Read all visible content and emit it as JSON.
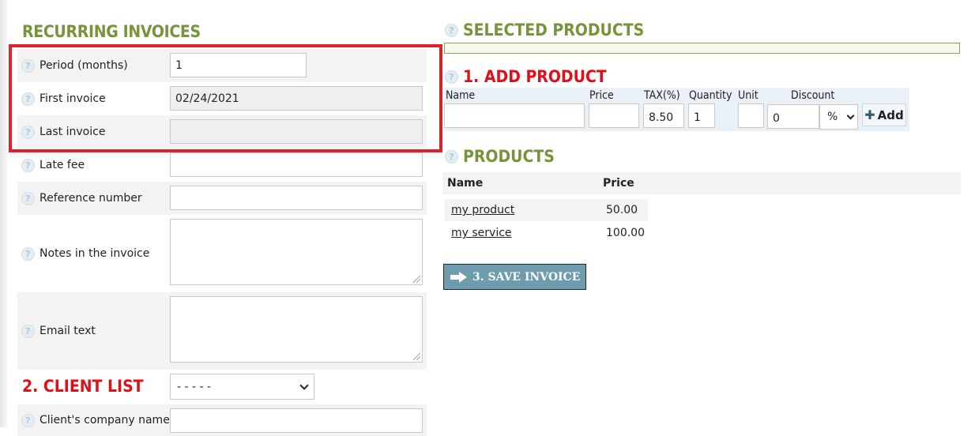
{
  "recurring": {
    "title": "RECURRING INVOICES",
    "fields": [
      {
        "label": "Period (months)",
        "value": "1"
      },
      {
        "label": "First invoice",
        "value": "02/24/2021"
      },
      {
        "label": "Last invoice",
        "value": ""
      },
      {
        "label": "Late fee",
        "value": ""
      },
      {
        "label": "Reference number",
        "value": ""
      },
      {
        "label": "Notes in the invoice",
        "value": ""
      },
      {
        "label": "Email text",
        "value": ""
      }
    ]
  },
  "client_list": {
    "title": "2. CLIENT LIST",
    "selected": "- - - - -",
    "company_label": "Client's company name",
    "company_value": ""
  },
  "selected_products": {
    "title": "SELECTED PRODUCTS"
  },
  "add_product": {
    "title": "1. ADD PRODUCT",
    "labels": {
      "name": "Name",
      "price": "Price",
      "tax": "TAX(%)",
      "quantity": "Quantity",
      "unit": "Unit",
      "discount": "Discount"
    },
    "values": {
      "name": "",
      "price": "",
      "tax": "8.50",
      "quantity": "1",
      "unit": "",
      "discount": "0",
      "discount_type": "%"
    },
    "add_label": "Add"
  },
  "products": {
    "title": "PRODUCTS",
    "columns": [
      "Name",
      "Price"
    ],
    "rows": [
      {
        "name": "my product",
        "price": "50.00"
      },
      {
        "name": "my service",
        "price": "100.00"
      }
    ]
  },
  "save_button": {
    "label": "3. SAVE INVOICE"
  },
  "colors": {
    "green_heading": "#76953a",
    "red_heading": "#e0101a",
    "highlight_border": "#e0202a",
    "save_button_bg": "#6e9cae"
  }
}
